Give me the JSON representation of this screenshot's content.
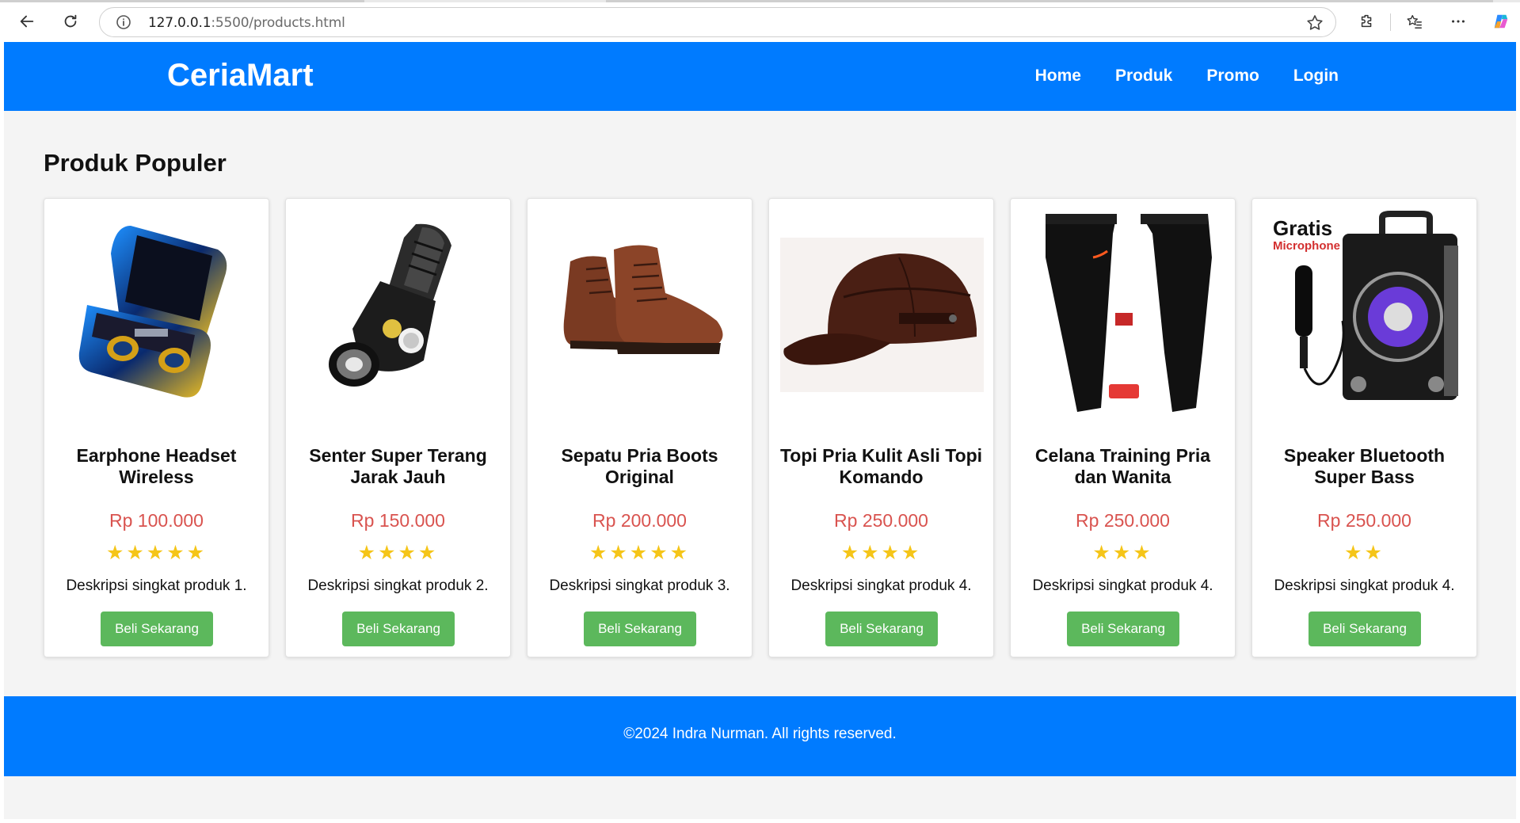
{
  "browser": {
    "url_host": "127.0.0.1",
    "url_path": ":5500/products.html"
  },
  "site": {
    "brand": "CeriaMart",
    "nav": [
      "Home",
      "Produk",
      "Promo",
      "Login"
    ]
  },
  "section_title": "Produk Populer",
  "products": [
    {
      "title": "Earphone Headset Wireless",
      "price": "Rp 100.000",
      "rating": 5,
      "stars": "★★★★★",
      "description": "Deskripsi singkat produk 1.",
      "button": "Beli Sekarang",
      "image": "earphone-image"
    },
    {
      "title": "Senter Super Terang Jarak Jauh",
      "price": "Rp 150.000",
      "rating": 4,
      "stars": "★★★★",
      "description": "Deskripsi singkat produk 2.",
      "button": "Beli Sekarang",
      "image": "flashlight-image"
    },
    {
      "title": "Sepatu Pria Boots Original",
      "price": "Rp 200.000",
      "rating": 5,
      "stars": "★★★★★",
      "description": "Deskripsi singkat produk 3.",
      "button": "Beli Sekarang",
      "image": "boots-image"
    },
    {
      "title": "Topi Pria Kulit Asli Topi Komando",
      "price": "Rp 250.000",
      "rating": 4,
      "stars": "★★★★",
      "description": "Deskripsi singkat produk 4.",
      "button": "Beli Sekarang",
      "image": "cap-image"
    },
    {
      "title": "Celana Training Pria dan Wanita",
      "price": "Rp 250.000",
      "rating": 3,
      "stars": "★★★",
      "description": "Deskripsi singkat produk 4.",
      "button": "Beli Sekarang",
      "image": "pants-image"
    },
    {
      "title": "Speaker Bluetooth Super Bass",
      "price": "Rp 250.000",
      "rating": 2,
      "stars": "★★",
      "description": "Deskripsi singkat produk 4.",
      "button": "Beli Sekarang",
      "image": "speaker-image",
      "image_text": [
        "Gratis",
        "Microphone"
      ]
    }
  ],
  "footer": "©2024 Indra Nurman. All rights reserved.",
  "colors": {
    "primary": "#007bff",
    "price": "#d9534f",
    "button": "#5cb85c",
    "star": "#f5c518",
    "background": "#f4f4f4"
  }
}
